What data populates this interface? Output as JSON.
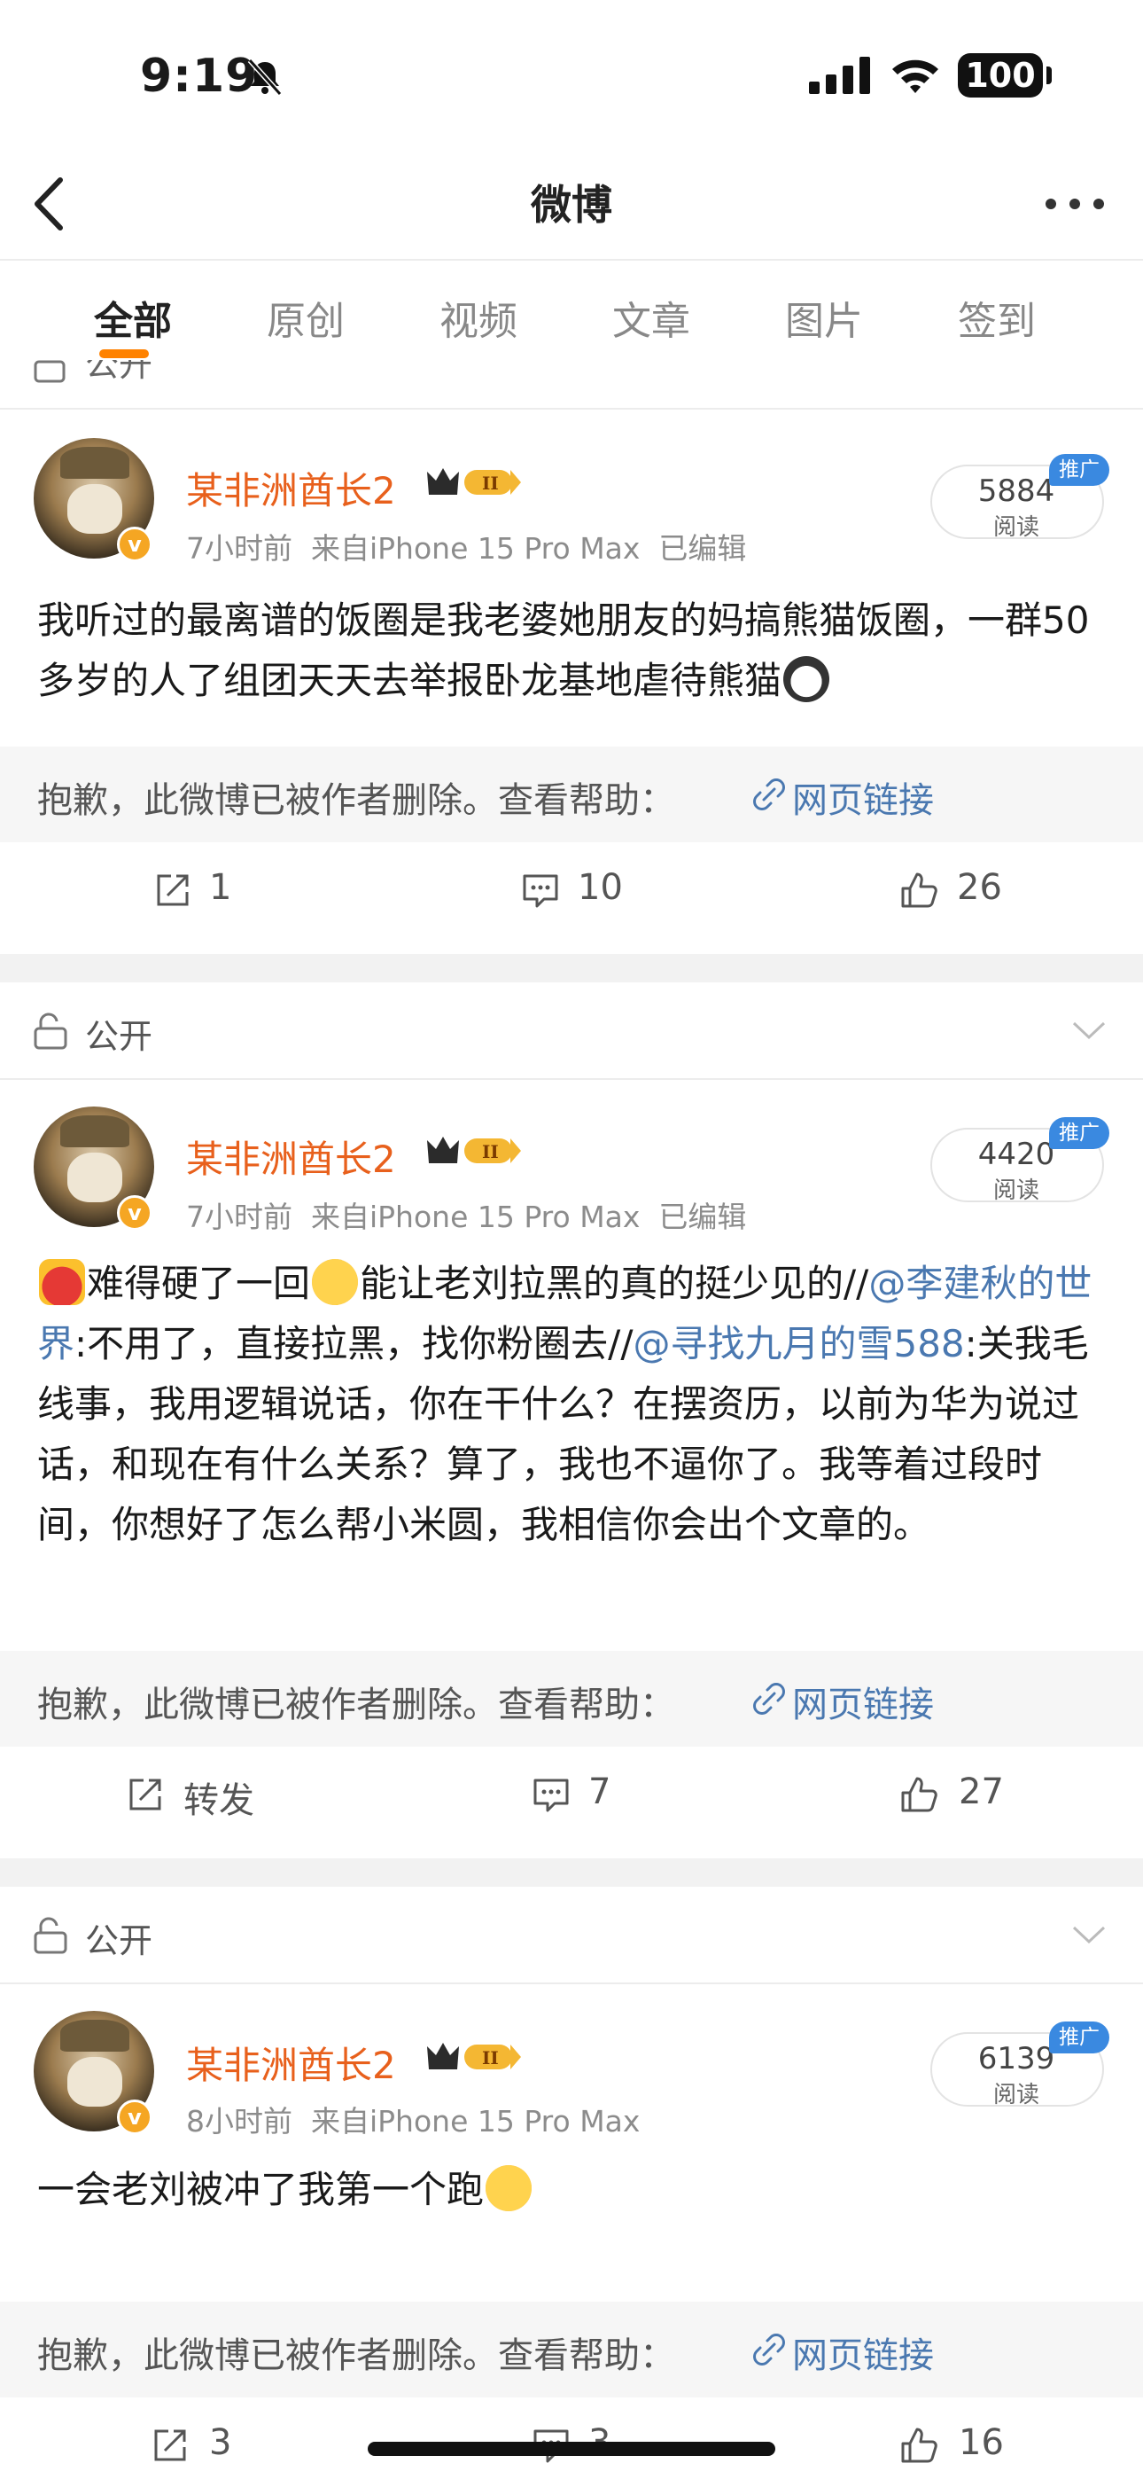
{
  "status_bar": {
    "time": "9:19",
    "battery": "100"
  },
  "nav": {
    "title": "微博"
  },
  "tabs": [
    {
      "label": "全部"
    },
    {
      "label": "原创"
    },
    {
      "label": "视频"
    },
    {
      "label": "文章"
    },
    {
      "label": "图片"
    },
    {
      "label": "签到"
    }
  ],
  "visibility_label": "公开",
  "colors": {
    "accent": "#ff8200",
    "username": "#e8601c",
    "link": "#4a78b0",
    "promo": "#3a89e0"
  },
  "deleted_notice": "抱歉，此微博已被作者删除。查看帮助：",
  "web_link": "网页链接",
  "read_label": "阅读",
  "promo_label": "推广",
  "posts": [
    {
      "username": "某非洲酋长2",
      "time": "7小时前",
      "source": "来自iPhone 15 Pro Max",
      "edited": "已编辑",
      "reads": "5884",
      "text": "我听过的最离谱的饭圈是我老婆她朋友的妈搞熊猫饭圈，一群50多岁的人了组团天天去举报卧龙基地虐待熊猫",
      "repost": "1",
      "comments": "10",
      "likes": "26"
    },
    {
      "username": "某非洲酋长2",
      "time": "7小时前",
      "source": "来自iPhone 15 Pro Max",
      "edited": "已编辑",
      "reads": "4420",
      "text_a": "难得硬了一回",
      "text_b": "能让老刘拉黑的真的挺少见的//",
      "mention_1": "@李建秋的世界",
      "text_c": ":不用了，直接拉黑，找你粉圈去//",
      "mention_2": "@寻找九月的雪588",
      "text_d": ":关我毛线事，我用逻辑说话，你在干什么？在摆资历，以前为华为说过话，和现在有什么关系？算了，我也不逼你了。我等着过段时间，你想好了怎么帮小米圆，我相信你会出个文章的。",
      "repost": "转发",
      "comments": "7",
      "likes": "27"
    },
    {
      "username": "某非洲酋长2",
      "time": "8小时前",
      "source": "来自iPhone 15 Pro Max",
      "reads": "6139",
      "text": "一会老刘被冲了我第一个跑",
      "repost": "3",
      "comments": "3",
      "likes": "16"
    }
  ]
}
